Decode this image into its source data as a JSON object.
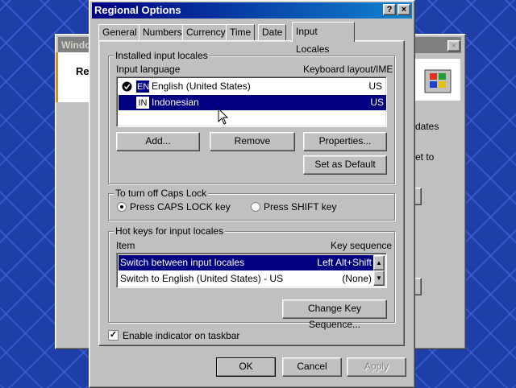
{
  "background_window": {
    "title_fragment": "Windo",
    "label_fragment": "Re",
    "side_text_1": "dates",
    "side_text_2": "et to"
  },
  "dialog": {
    "title": "Regional Options",
    "help_button": "?",
    "close_button": "×",
    "tabs": [
      {
        "label": "General"
      },
      {
        "label": "Numbers"
      },
      {
        "label": "Currency"
      },
      {
        "label": "Time"
      },
      {
        "label": "Date"
      },
      {
        "label": "Input Locales",
        "active": true
      }
    ],
    "installed": {
      "group_label": "Installed input locales",
      "col_language": "Input language",
      "col_layout": "Keyboard layout/IME",
      "rows": [
        {
          "code": "EN",
          "language": "English (United States)",
          "layout": "US",
          "is_default": true,
          "selected": false
        },
        {
          "code": "IN",
          "language": "Indonesian",
          "layout": "US",
          "is_default": false,
          "selected": true
        }
      ],
      "add_button": "Add...",
      "remove_button": "Remove",
      "properties_button": "Properties...",
      "set_default_button": "Set as Default"
    },
    "caps_lock": {
      "group_label": "To turn off Caps Lock",
      "option_caps": "Press CAPS LOCK key",
      "option_shift": "Press SHIFT key",
      "selected": "caps"
    },
    "hotkeys": {
      "group_label": "Hot keys for input locales",
      "col_item": "Item",
      "col_sequence": "Key sequence",
      "rows": [
        {
          "item": "Switch between input locales",
          "sequence": "Left Alt+Shift",
          "selected": true
        },
        {
          "item": "Switch to English (United States) - US",
          "sequence": "(None)",
          "selected": false
        }
      ],
      "change_button": "Change Key Sequence..."
    },
    "enable_indicator": {
      "label": "Enable indicator on taskbar",
      "checked": true
    },
    "ok_button": "OK",
    "cancel_button": "Cancel",
    "apply_button": "Apply"
  },
  "colors": {
    "selection": "#000080",
    "face": "#c0c0c0",
    "desktop": "#1f3fa8"
  }
}
